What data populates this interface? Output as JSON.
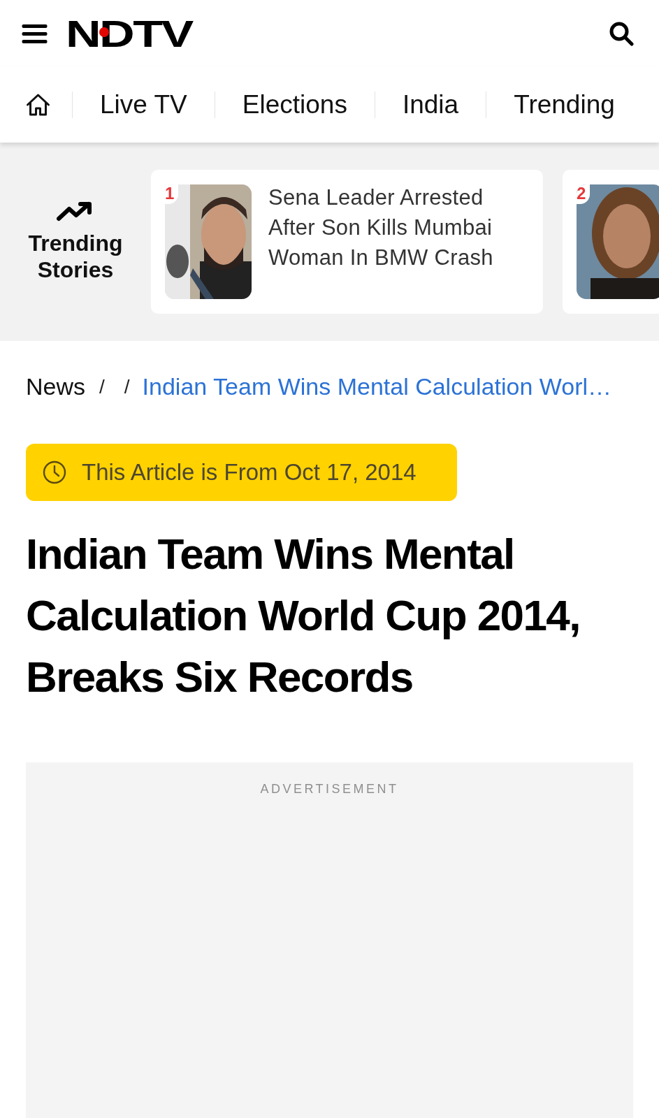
{
  "header": {
    "logo": "NDTV"
  },
  "nav": [
    {
      "label": "Live TV"
    },
    {
      "label": "Elections"
    },
    {
      "label": "India"
    },
    {
      "label": "Trending"
    }
  ],
  "trending": {
    "title": "Trending Stories",
    "stories": [
      {
        "rank": "1",
        "headline": "Sena Leader Arrested After Son Kills Mumbai Woman In BMW Crash"
      },
      {
        "rank": "2"
      }
    ]
  },
  "breadcrumb": [
    {
      "kind": "link",
      "label": "News"
    },
    {
      "kind": "separator",
      "label": "/"
    },
    {
      "kind": "separator",
      "label": "/"
    },
    {
      "kind": "current",
      "label": "Indian Team Wins Mental Calculation Worl…"
    }
  ],
  "date_badge": "This Article is From Oct 17, 2014",
  "headline": "Indian Team Wins Mental Calculation World Cup 2014, Breaks Six Records",
  "advertisement": {
    "label": "ADVERTISEMENT"
  }
}
